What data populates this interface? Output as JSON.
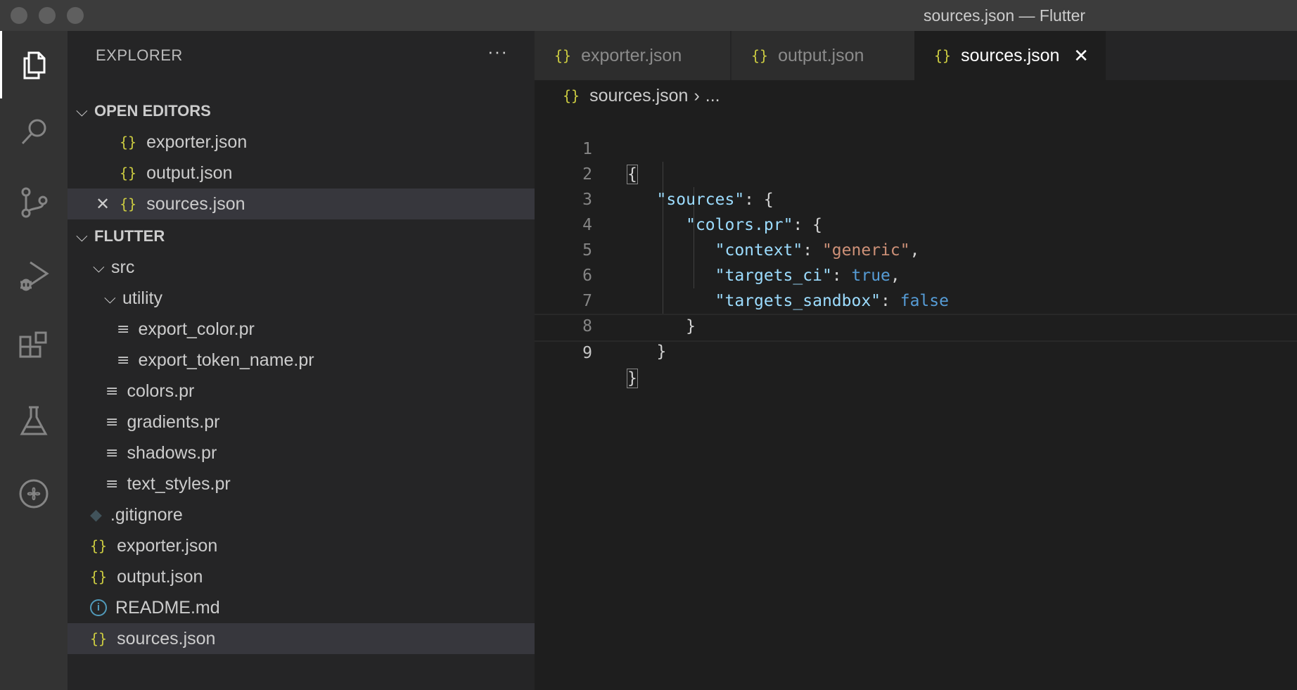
{
  "window": {
    "title": "sources.json — Flutter"
  },
  "sidebar": {
    "header": "EXPLORER",
    "more": "···",
    "open_editors": {
      "title": "OPEN EDITORS",
      "items": [
        {
          "name": "exporter.json"
        },
        {
          "name": "output.json"
        },
        {
          "name": "sources.json"
        }
      ]
    },
    "project": {
      "title": "FLUTTER",
      "folder_src": "src",
      "folder_utility": "utility",
      "utility_files": [
        "export_color.pr",
        "export_token_name.pr"
      ],
      "src_files": [
        "colors.pr",
        "gradients.pr",
        "shadows.pr",
        "text_styles.pr"
      ],
      "root_files": [
        ".gitignore",
        "exporter.json",
        "output.json",
        "README.md",
        "sources.json"
      ]
    }
  },
  "tabs": [
    {
      "label": "exporter.json"
    },
    {
      "label": "output.json"
    },
    {
      "label": "sources.json"
    }
  ],
  "breadcrumb": {
    "file": "sources.json",
    "rest": "..."
  },
  "editor": {
    "line_numbers": [
      "1",
      "2",
      "3",
      "4",
      "5",
      "6",
      "7",
      "8",
      "9"
    ],
    "lines": [
      {
        "p": "{"
      },
      {
        "i": "   ",
        "k": "\"sources\"",
        "p": ": {"
      },
      {
        "i": "      ",
        "k": "\"colors.pr\"",
        "p": ": {"
      },
      {
        "i": "         ",
        "k": "\"context\"",
        "p": ": ",
        "s": "\"generic\"",
        "e": ","
      },
      {
        "i": "         ",
        "k": "\"targets_ci\"",
        "p": ": ",
        "b": "true",
        "e": ","
      },
      {
        "i": "         ",
        "k": "\"targets_sandbox\"",
        "p": ": ",
        "b": "false"
      },
      {
        "i": "      ",
        "p": "}"
      },
      {
        "i": "   ",
        "p": "}"
      },
      {
        "p": "}"
      }
    ]
  },
  "colors": {
    "json_icon": "#cbcb41",
    "key": "#9cdcfe",
    "string": "#ce9178",
    "boolean": "#569cd6"
  },
  "icons": {
    "activity": [
      "files-icon",
      "search-icon",
      "source-control-icon",
      "run-debug-icon",
      "extensions-icon",
      "testing-icon",
      "remote-icon"
    ]
  }
}
